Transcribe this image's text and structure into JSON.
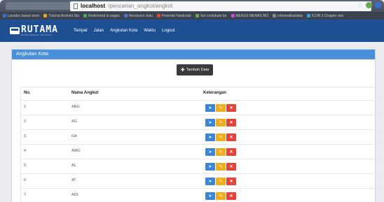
{
  "browser": {
    "url_host": "localhost",
    "url_path": "/pencarian_angkot/angkot",
    "bookmarks": [
      {
        "label": "Laradoc based seon",
        "color": "#3a6fd8"
      },
      {
        "label": "Tutorial Android Stu",
        "color": "#e0a52a"
      },
      {
        "label": "Redirected to pages",
        "color": "#5aa05a"
      },
      {
        "label": "Heroicons sistu",
        "color": "#4a74c8"
      },
      {
        "label": "Promote Hardcode",
        "color": "#d64a3a"
      },
      {
        "label": "Sol contribute bo",
        "color": "#6aa84f"
      },
      {
        "label": "MENUS MENAS MO",
        "color": "#c94ad6"
      },
      {
        "label": "informatika/data",
        "color": "#888888"
      },
      {
        "label": "ICON 3 Chapter ano",
        "color": "#3a9fd8"
      }
    ]
  },
  "navbar": {
    "logo_word": "RUTAMA",
    "logo_tag": "RUTE ANGKOT MALANG",
    "items": [
      "Tempat",
      "Jalan",
      "Angkutan Kota",
      "Waktu",
      "Logout"
    ]
  },
  "panel": {
    "title": "Angkutan Kota",
    "add_button": "Tambah Data"
  },
  "table": {
    "headers": {
      "no": "No.",
      "name": "Nama Angkut",
      "ket": "Keterangan"
    },
    "rows": [
      {
        "no": "1",
        "name": "ABG"
      },
      {
        "no": "2",
        "name": "AG"
      },
      {
        "no": "3",
        "name": "GA"
      },
      {
        "no": "4",
        "name": "AMG"
      },
      {
        "no": "5",
        "name": "AL"
      },
      {
        "no": "6",
        "name": "AT"
      },
      {
        "no": "7",
        "name": "ADL"
      }
    ]
  },
  "colors": {
    "navbar": "#1e4f93",
    "panel_heading": "#4a8fdb",
    "view_button": "#3b87d6",
    "edit_button": "#f0ad1e",
    "delete_button": "#e4433a"
  },
  "icons": {
    "view": "send-icon",
    "edit": "pencil-icon",
    "delete": "close-icon"
  }
}
